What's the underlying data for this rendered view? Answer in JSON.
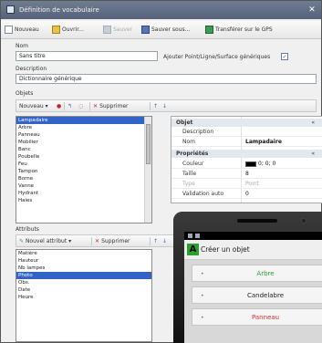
{
  "window": {
    "title": "Définition de vocabulaire"
  },
  "toolbar": {
    "new_label": "Nouveau",
    "open_label": "Ouvrir...",
    "save_label": "Sauver",
    "save_as_label": "Sauver sous...",
    "transfer_label": "Transférer sur le GPS"
  },
  "form": {
    "name_label": "Nom",
    "name_value": "Sans titre",
    "add_point_label": "Ajouter Point/Ligne/Surface génériques",
    "add_point_checked": true,
    "description_label": "Description",
    "description_value": "Dictionnaire générique"
  },
  "objects": {
    "section_label": "Objets",
    "new_label": "Nouveau",
    "delete_label": "Supprimer",
    "items": [
      "Lampadaire",
      "Arbre",
      "Panneau",
      "Mobilier",
      "Banc",
      "Poubelle",
      "Feu",
      "Tampon",
      "Borne",
      "Vanne",
      "Hydrant",
      "Haies"
    ],
    "selected_index": 0
  },
  "properties": {
    "object_category": "Objet",
    "description_label": "Description",
    "description_value": "",
    "name_label": "Nom",
    "name_value": "Lampadaire",
    "props_category": "Propriétés",
    "color_label": "Couleur",
    "color_value": "0; 0; 0",
    "color_hex": "#000000",
    "size_label": "Taille",
    "size_value": "8",
    "type_label": "Type",
    "type_value": "Point",
    "validation_label": "Validation auto",
    "validation_value": "0"
  },
  "attributes": {
    "section_label": "Attributs",
    "new_label": "Nouvel attribut",
    "delete_label": "Supprimer",
    "items": [
      "Matière",
      "Hauteur",
      "Nb lampes",
      "Photo",
      "Obs.",
      "Date",
      "Heure"
    ],
    "selected_index": 3
  },
  "phone": {
    "title": "Créer un objet",
    "logo_letter": "A",
    "items": [
      "Arbre",
      "Candelabre",
      "Panneau"
    ]
  },
  "colors": {
    "selection": "#3264c8",
    "accent_green": "#2ca02c",
    "delete_red": "#c0282a"
  }
}
